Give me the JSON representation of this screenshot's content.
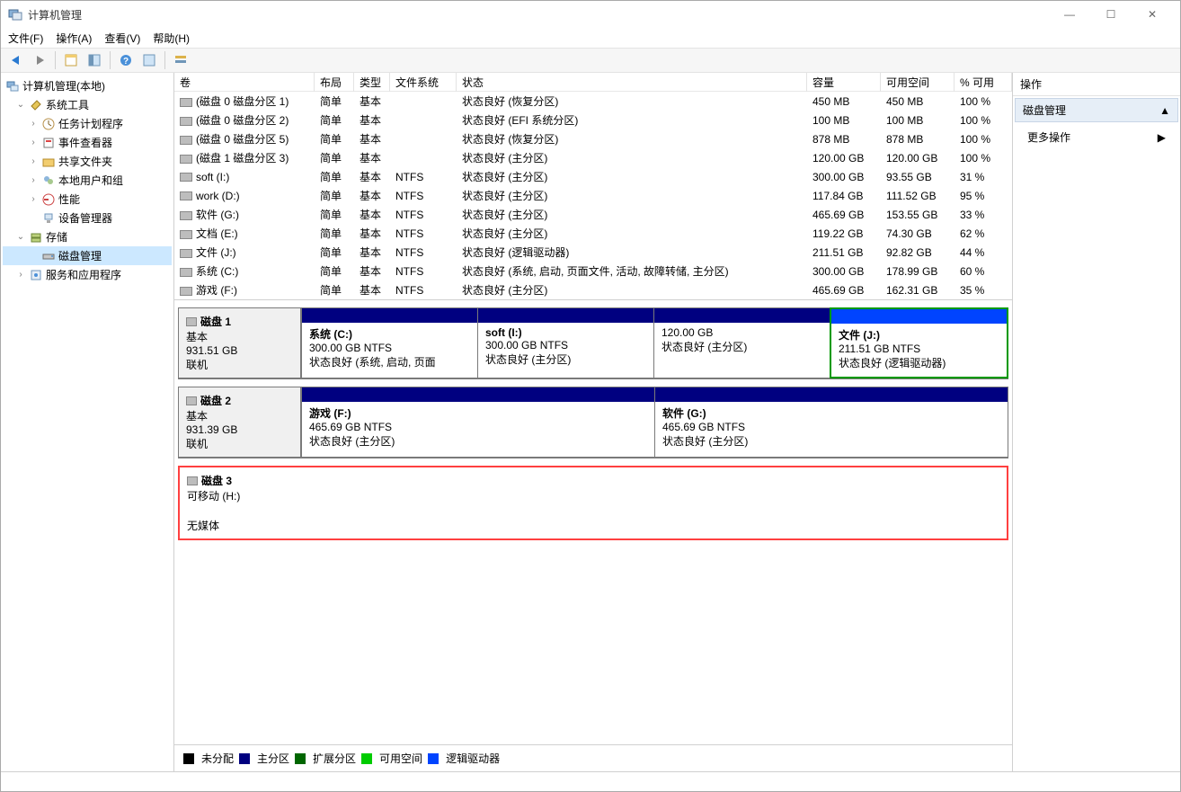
{
  "window": {
    "title": "计算机管理",
    "min": "—",
    "max": "☐",
    "close": "✕"
  },
  "menu": {
    "file": "文件(F)",
    "action": "操作(A)",
    "view": "查看(V)",
    "help": "帮助(H)"
  },
  "tree": {
    "root": "计算机管理(本地)",
    "sys_tools": "系统工具",
    "task_sched": "任务计划程序",
    "event_viewer": "事件查看器",
    "shared": "共享文件夹",
    "local_users": "本地用户和组",
    "perf": "性能",
    "dev_mgr": "设备管理器",
    "storage": "存储",
    "disk_mgmt": "磁盘管理",
    "svc_apps": "服务和应用程序"
  },
  "columns": {
    "volume": "卷",
    "layout": "布局",
    "type": "类型",
    "fs": "文件系统",
    "status": "状态",
    "capacity": "容量",
    "free": "可用空间",
    "pct": "% 可用"
  },
  "volumes": [
    {
      "name": "(磁盘 0 磁盘分区 1)",
      "layout": "简单",
      "type": "基本",
      "fs": "",
      "status": "状态良好 (恢复分区)",
      "cap": "450 MB",
      "free": "450 MB",
      "pct": "100 %"
    },
    {
      "name": "(磁盘 0 磁盘分区 2)",
      "layout": "简单",
      "type": "基本",
      "fs": "",
      "status": "状态良好 (EFI 系统分区)",
      "cap": "100 MB",
      "free": "100 MB",
      "pct": "100 %"
    },
    {
      "name": "(磁盘 0 磁盘分区 5)",
      "layout": "简单",
      "type": "基本",
      "fs": "",
      "status": "状态良好 (恢复分区)",
      "cap": "878 MB",
      "free": "878 MB",
      "pct": "100 %"
    },
    {
      "name": "(磁盘 1 磁盘分区 3)",
      "layout": "简单",
      "type": "基本",
      "fs": "",
      "status": "状态良好 (主分区)",
      "cap": "120.00 GB",
      "free": "120.00 GB",
      "pct": "100 %"
    },
    {
      "name": "soft (I:)",
      "layout": "简单",
      "type": "基本",
      "fs": "NTFS",
      "status": "状态良好 (主分区)",
      "cap": "300.00 GB",
      "free": "93.55 GB",
      "pct": "31 %"
    },
    {
      "name": "work (D:)",
      "layout": "简单",
      "type": "基本",
      "fs": "NTFS",
      "status": "状态良好 (主分区)",
      "cap": "117.84 GB",
      "free": "111.52 GB",
      "pct": "95 %"
    },
    {
      "name": "软件 (G:)",
      "layout": "简单",
      "type": "基本",
      "fs": "NTFS",
      "status": "状态良好 (主分区)",
      "cap": "465.69 GB",
      "free": "153.55 GB",
      "pct": "33 %"
    },
    {
      "name": "文档 (E:)",
      "layout": "简单",
      "type": "基本",
      "fs": "NTFS",
      "status": "状态良好 (主分区)",
      "cap": "119.22 GB",
      "free": "74.30 GB",
      "pct": "62 %"
    },
    {
      "name": "文件 (J:)",
      "layout": "简单",
      "type": "基本",
      "fs": "NTFS",
      "status": "状态良好 (逻辑驱动器)",
      "cap": "211.51 GB",
      "free": "92.82 GB",
      "pct": "44 %"
    },
    {
      "name": "系统 (C:)",
      "layout": "简单",
      "type": "基本",
      "fs": "NTFS",
      "status": "状态良好 (系统, 启动, 页面文件, 活动, 故障转储, 主分区)",
      "cap": "300.00 GB",
      "free": "178.99 GB",
      "pct": "60 %"
    },
    {
      "name": "游戏 (F:)",
      "layout": "简单",
      "type": "基本",
      "fs": "NTFS",
      "status": "状态良好 (主分区)",
      "cap": "465.69 GB",
      "free": "162.31 GB",
      "pct": "35 %"
    }
  ],
  "disks": {
    "d1": {
      "title": "磁盘 1",
      "type": "基本",
      "cap": "931.51 GB",
      "state": "联机",
      "parts": [
        {
          "name": "系统  (C:)",
          "size": "300.00 GB NTFS",
          "status": "状态良好 (系统, 启动, 页面",
          "stripe": "primary",
          "selected": false
        },
        {
          "name": "soft  (I:)",
          "size": "300.00 GB NTFS",
          "status": "状态良好 (主分区)",
          "stripe": "primary",
          "selected": false
        },
        {
          "name": "",
          "size": "120.00 GB",
          "status": "状态良好 (主分区)",
          "stripe": "primary",
          "selected": false
        },
        {
          "name": "文件  (J:)",
          "size": "211.51 GB NTFS",
          "status": "状态良好 (逻辑驱动器)",
          "stripe": "logical",
          "selected": true
        }
      ]
    },
    "d2": {
      "title": "磁盘 2",
      "type": "基本",
      "cap": "931.39 GB",
      "state": "联机",
      "parts": [
        {
          "name": "游戏  (F:)",
          "size": "465.69 GB NTFS",
          "status": "状态良好 (主分区)",
          "stripe": "primary",
          "selected": false
        },
        {
          "name": "软件  (G:)",
          "size": "465.69 GB NTFS",
          "status": "状态良好 (主分区)",
          "stripe": "primary",
          "selected": false
        }
      ]
    },
    "d3": {
      "title": "磁盘 3",
      "type": "可移动 (H:)",
      "cap": "",
      "state": "无媒体"
    }
  },
  "legend": {
    "unalloc": "未分配",
    "primary": "主分区",
    "extended": "扩展分区",
    "free": "可用空间",
    "logical": "逻辑驱动器"
  },
  "actions": {
    "header": "操作",
    "title": "磁盘管理",
    "more": "更多操作",
    "arrow_up": "▲",
    "arrow_right": "▶"
  }
}
